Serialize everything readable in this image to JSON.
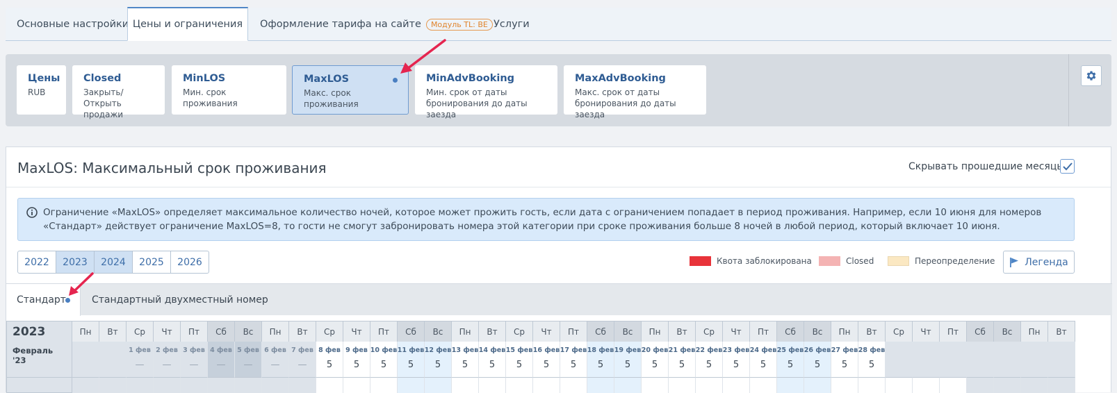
{
  "top_tabs": [
    {
      "label": "Основные настройки"
    },
    {
      "label": "Цены и ограничения"
    },
    {
      "label": "Оформление тарифа на сайте",
      "badge": "Модуль TL: BE"
    },
    {
      "label": "Услуги"
    }
  ],
  "restrictions": [
    {
      "title": "Цены",
      "desc": "RUB"
    },
    {
      "title": "Closed",
      "desc": "Закрыть/Открыть продажи"
    },
    {
      "title": "MinLOS",
      "desc": "Мин. срок проживания"
    },
    {
      "title": "MaxLOS",
      "desc": "Макс. срок проживания"
    },
    {
      "title": "MinAdvBooking",
      "desc": "Мин. срок от даты бронирования до даты заезда"
    },
    {
      "title": "MaxAdvBooking",
      "desc": "Макс. срок от даты бронирования до даты заезда"
    }
  ],
  "main": {
    "title": "MaxLOS: Максимальный срок проживания",
    "hide_past_label": "Скрывать прошедшие месяцы",
    "hide_past_checked": true,
    "info": "Ограничение «MaxLOS» определяет максимальное количество ночей, которое может прожить гость, если дата с ограничением попадает в период проживания. Например, если 10 июня для номеров «Стандарт» действует ограничение MaxLOS=8, то гости не смогут забронировать номера этой категории при сроке проживания больше 8 ночей в любой период, который включает 10 июня.",
    "years": [
      "2022",
      "2023",
      "2024",
      "2025",
      "2026"
    ],
    "selected_years": [
      "2023",
      "2024"
    ],
    "legend": [
      {
        "label": "Квота заблокирована",
        "color": "#e8333a"
      },
      {
        "label": "Closed",
        "color": "#f4b3b3"
      },
      {
        "label": "Переопределение",
        "color": "#fbe8c2"
      }
    ],
    "legend_button": "Легенда"
  },
  "room_tabs": [
    "Стандарт",
    "Стандартный двухместный номер"
  ],
  "calendar": {
    "year": "2023",
    "weekdays": [
      "Пн",
      "Вт",
      "Ср",
      "Чт",
      "Пт",
      "Сб",
      "Вс",
      "Пн",
      "Вт",
      "Ср",
      "Чт",
      "Пт",
      "Сб",
      "Вс",
      "Пн",
      "Вт",
      "Ср",
      "Чт",
      "Пт",
      "Сб",
      "Вс",
      "Пн",
      "Вт",
      "Ср",
      "Чт",
      "Пт",
      "Сб",
      "Вс",
      "Пн",
      "Вт",
      "Ср",
      "Чт",
      "Пт",
      "Сб",
      "Вс",
      "Пн",
      "Вт"
    ],
    "month_label": "Февраль '23",
    "leading_empty": 2,
    "past_days": 7,
    "days": [
      {
        "date": "1 фев",
        "value": "—"
      },
      {
        "date": "2 фев",
        "value": "—"
      },
      {
        "date": "3 фев",
        "value": "—"
      },
      {
        "date": "4 фев",
        "value": "—"
      },
      {
        "date": "5 фев",
        "value": "—"
      },
      {
        "date": "6 фев",
        "value": "—"
      },
      {
        "date": "7 фев",
        "value": "—"
      },
      {
        "date": "8 фев",
        "value": "5"
      },
      {
        "date": "9 фев",
        "value": "5"
      },
      {
        "date": "10 фев",
        "value": "5"
      },
      {
        "date": "11 фев",
        "value": "5"
      },
      {
        "date": "12 фев",
        "value": "5"
      },
      {
        "date": "13 фев",
        "value": "5"
      },
      {
        "date": "14 фев",
        "value": "5"
      },
      {
        "date": "15 фев",
        "value": "5"
      },
      {
        "date": "16 фев",
        "value": "5"
      },
      {
        "date": "17 фев",
        "value": "5"
      },
      {
        "date": "18 фев",
        "value": "5"
      },
      {
        "date": "19 фев",
        "value": "5"
      },
      {
        "date": "20 фев",
        "value": "5"
      },
      {
        "date": "21 фев",
        "value": "5"
      },
      {
        "date": "22 фев",
        "value": "5"
      },
      {
        "date": "23 фев",
        "value": "5"
      },
      {
        "date": "24 фев",
        "value": "5"
      },
      {
        "date": "25 фев",
        "value": "5"
      },
      {
        "date": "26 фев",
        "value": "5"
      },
      {
        "date": "27 фев",
        "value": "5"
      },
      {
        "date": "28 фев",
        "value": "5"
      }
    ]
  },
  "colors": {
    "accent": "#4f86c6",
    "arrow": "#e5254f",
    "dot": "#4a7fc1"
  }
}
